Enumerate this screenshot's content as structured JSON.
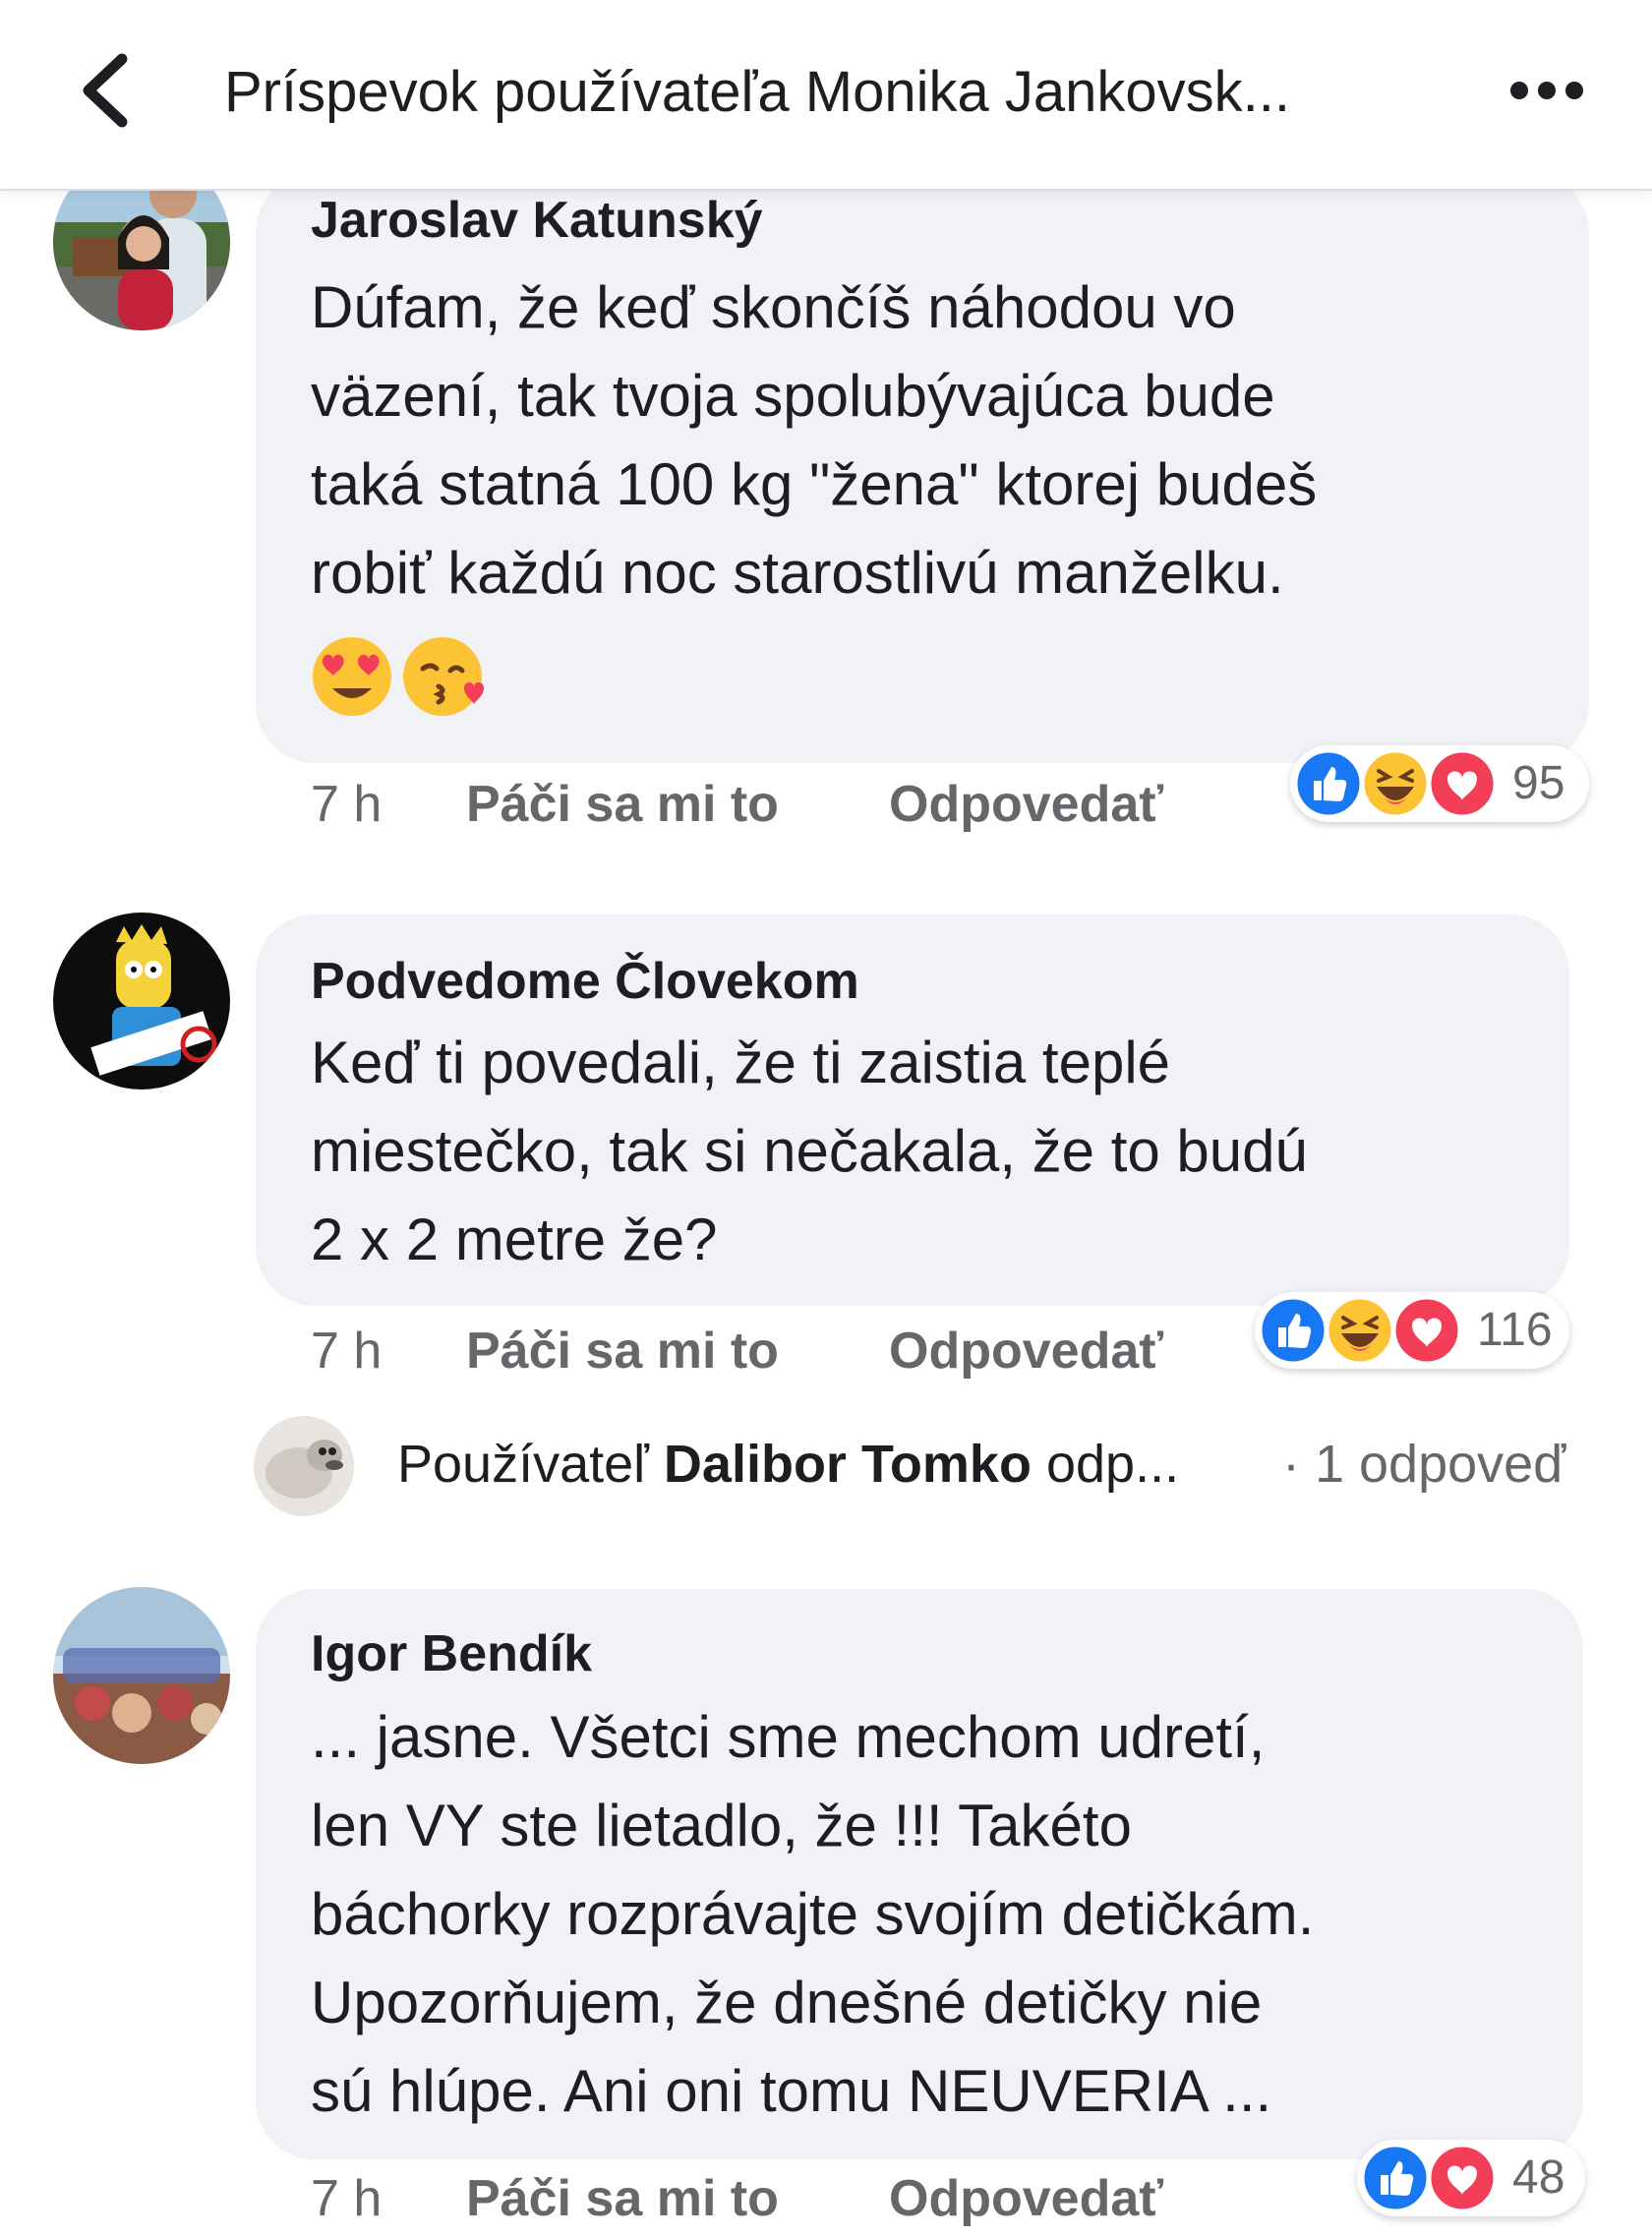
{
  "header": {
    "title": "Príspevok používateľa Monika Jankovsk...",
    "back_icon": "chevron-left-icon",
    "more_icon": "more-horizontal-icon"
  },
  "comments": [
    {
      "author": "Jaroslav Katunský",
      "lines": [
        "Dúfam, že keď skončíš náhodou vo",
        "väzení, tak tvoja spolubývajúca bude",
        "taká statná 100 kg \"žena\" ktorej budeš",
        "robiť každú noc starostlivú manželku."
      ],
      "emojis": [
        "heart-eyes-emoji",
        "kissing-heart-emoji"
      ],
      "time": "7 h",
      "like_label": "Páči sa mi to",
      "reply_label": "Odpovedať",
      "reactions": [
        "like",
        "haha",
        "love"
      ],
      "reaction_count": "95"
    },
    {
      "author": "Podvedome Človekom",
      "lines": [
        "Keď ti povedali, že ti zaistia teplé",
        "miestečko, tak si nečakala, že to budú",
        "2 x 2 metre že?"
      ],
      "time": "7 h",
      "like_label": "Páči sa mi to",
      "reply_label": "Odpovedať",
      "reactions": [
        "like",
        "haha",
        "love"
      ],
      "reaction_count": "116",
      "reply_preview": {
        "prefix": "Používateľ",
        "name": "Dalibor Tomko",
        "suffix": "odp...",
        "count": "· 1 odpoveď"
      }
    },
    {
      "author": "Igor Bendík",
      "lines": [
        "... jasne. Všetci sme mechom udretí,",
        "len VY ste lietadlo, že !!! Takéto",
        "báchorky rozprávajte svojím detičkám.",
        "Upozorňujem, že dnešné detičky nie",
        "sú hlúpe. Ani oni tomu NEUVERIA ..."
      ],
      "time": "7 h",
      "like_label": "Páči sa mi to",
      "reply_label": "Odpovedať",
      "reactions": [
        "like",
        "love"
      ],
      "reaction_count": "48"
    }
  ],
  "colors": {
    "bubble": "#f0f2f5",
    "meta_text": "#65676b",
    "like_blue": "#1877f2",
    "love_red": "#f33e58",
    "haha_yellow": "#fcc434"
  }
}
